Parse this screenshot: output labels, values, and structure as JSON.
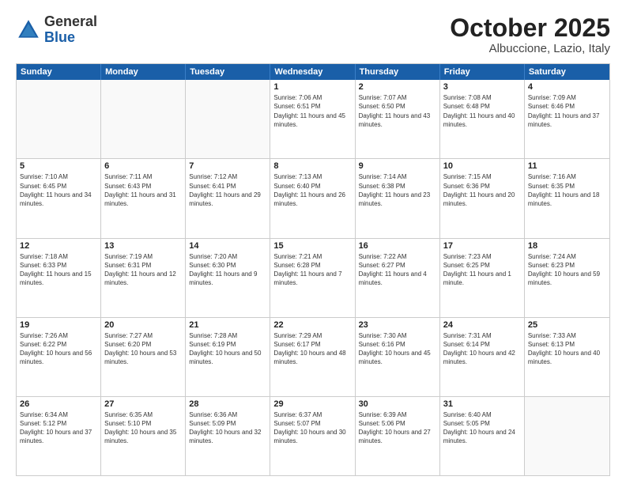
{
  "logo": {
    "general": "General",
    "blue": "Blue"
  },
  "title": "October 2025",
  "location": "Albuccione, Lazio, Italy",
  "header_days": [
    "Sunday",
    "Monday",
    "Tuesday",
    "Wednesday",
    "Thursday",
    "Friday",
    "Saturday"
  ],
  "rows": [
    [
      {
        "day": "",
        "content": ""
      },
      {
        "day": "",
        "content": ""
      },
      {
        "day": "",
        "content": ""
      },
      {
        "day": "1",
        "content": "Sunrise: 7:06 AM\nSunset: 6:51 PM\nDaylight: 11 hours and 45 minutes."
      },
      {
        "day": "2",
        "content": "Sunrise: 7:07 AM\nSunset: 6:50 PM\nDaylight: 11 hours and 43 minutes."
      },
      {
        "day": "3",
        "content": "Sunrise: 7:08 AM\nSunset: 6:48 PM\nDaylight: 11 hours and 40 minutes."
      },
      {
        "day": "4",
        "content": "Sunrise: 7:09 AM\nSunset: 6:46 PM\nDaylight: 11 hours and 37 minutes."
      }
    ],
    [
      {
        "day": "5",
        "content": "Sunrise: 7:10 AM\nSunset: 6:45 PM\nDaylight: 11 hours and 34 minutes."
      },
      {
        "day": "6",
        "content": "Sunrise: 7:11 AM\nSunset: 6:43 PM\nDaylight: 11 hours and 31 minutes."
      },
      {
        "day": "7",
        "content": "Sunrise: 7:12 AM\nSunset: 6:41 PM\nDaylight: 11 hours and 29 minutes."
      },
      {
        "day": "8",
        "content": "Sunrise: 7:13 AM\nSunset: 6:40 PM\nDaylight: 11 hours and 26 minutes."
      },
      {
        "day": "9",
        "content": "Sunrise: 7:14 AM\nSunset: 6:38 PM\nDaylight: 11 hours and 23 minutes."
      },
      {
        "day": "10",
        "content": "Sunrise: 7:15 AM\nSunset: 6:36 PM\nDaylight: 11 hours and 20 minutes."
      },
      {
        "day": "11",
        "content": "Sunrise: 7:16 AM\nSunset: 6:35 PM\nDaylight: 11 hours and 18 minutes."
      }
    ],
    [
      {
        "day": "12",
        "content": "Sunrise: 7:18 AM\nSunset: 6:33 PM\nDaylight: 11 hours and 15 minutes."
      },
      {
        "day": "13",
        "content": "Sunrise: 7:19 AM\nSunset: 6:31 PM\nDaylight: 11 hours and 12 minutes."
      },
      {
        "day": "14",
        "content": "Sunrise: 7:20 AM\nSunset: 6:30 PM\nDaylight: 11 hours and 9 minutes."
      },
      {
        "day": "15",
        "content": "Sunrise: 7:21 AM\nSunset: 6:28 PM\nDaylight: 11 hours and 7 minutes."
      },
      {
        "day": "16",
        "content": "Sunrise: 7:22 AM\nSunset: 6:27 PM\nDaylight: 11 hours and 4 minutes."
      },
      {
        "day": "17",
        "content": "Sunrise: 7:23 AM\nSunset: 6:25 PM\nDaylight: 11 hours and 1 minute."
      },
      {
        "day": "18",
        "content": "Sunrise: 7:24 AM\nSunset: 6:23 PM\nDaylight: 10 hours and 59 minutes."
      }
    ],
    [
      {
        "day": "19",
        "content": "Sunrise: 7:26 AM\nSunset: 6:22 PM\nDaylight: 10 hours and 56 minutes."
      },
      {
        "day": "20",
        "content": "Sunrise: 7:27 AM\nSunset: 6:20 PM\nDaylight: 10 hours and 53 minutes."
      },
      {
        "day": "21",
        "content": "Sunrise: 7:28 AM\nSunset: 6:19 PM\nDaylight: 10 hours and 50 minutes."
      },
      {
        "day": "22",
        "content": "Sunrise: 7:29 AM\nSunset: 6:17 PM\nDaylight: 10 hours and 48 minutes."
      },
      {
        "day": "23",
        "content": "Sunrise: 7:30 AM\nSunset: 6:16 PM\nDaylight: 10 hours and 45 minutes."
      },
      {
        "day": "24",
        "content": "Sunrise: 7:31 AM\nSunset: 6:14 PM\nDaylight: 10 hours and 42 minutes."
      },
      {
        "day": "25",
        "content": "Sunrise: 7:33 AM\nSunset: 6:13 PM\nDaylight: 10 hours and 40 minutes."
      }
    ],
    [
      {
        "day": "26",
        "content": "Sunrise: 6:34 AM\nSunset: 5:12 PM\nDaylight: 10 hours and 37 minutes."
      },
      {
        "day": "27",
        "content": "Sunrise: 6:35 AM\nSunset: 5:10 PM\nDaylight: 10 hours and 35 minutes."
      },
      {
        "day": "28",
        "content": "Sunrise: 6:36 AM\nSunset: 5:09 PM\nDaylight: 10 hours and 32 minutes."
      },
      {
        "day": "29",
        "content": "Sunrise: 6:37 AM\nSunset: 5:07 PM\nDaylight: 10 hours and 30 minutes."
      },
      {
        "day": "30",
        "content": "Sunrise: 6:39 AM\nSunset: 5:06 PM\nDaylight: 10 hours and 27 minutes."
      },
      {
        "day": "31",
        "content": "Sunrise: 6:40 AM\nSunset: 5:05 PM\nDaylight: 10 hours and 24 minutes."
      },
      {
        "day": "",
        "content": ""
      }
    ]
  ]
}
